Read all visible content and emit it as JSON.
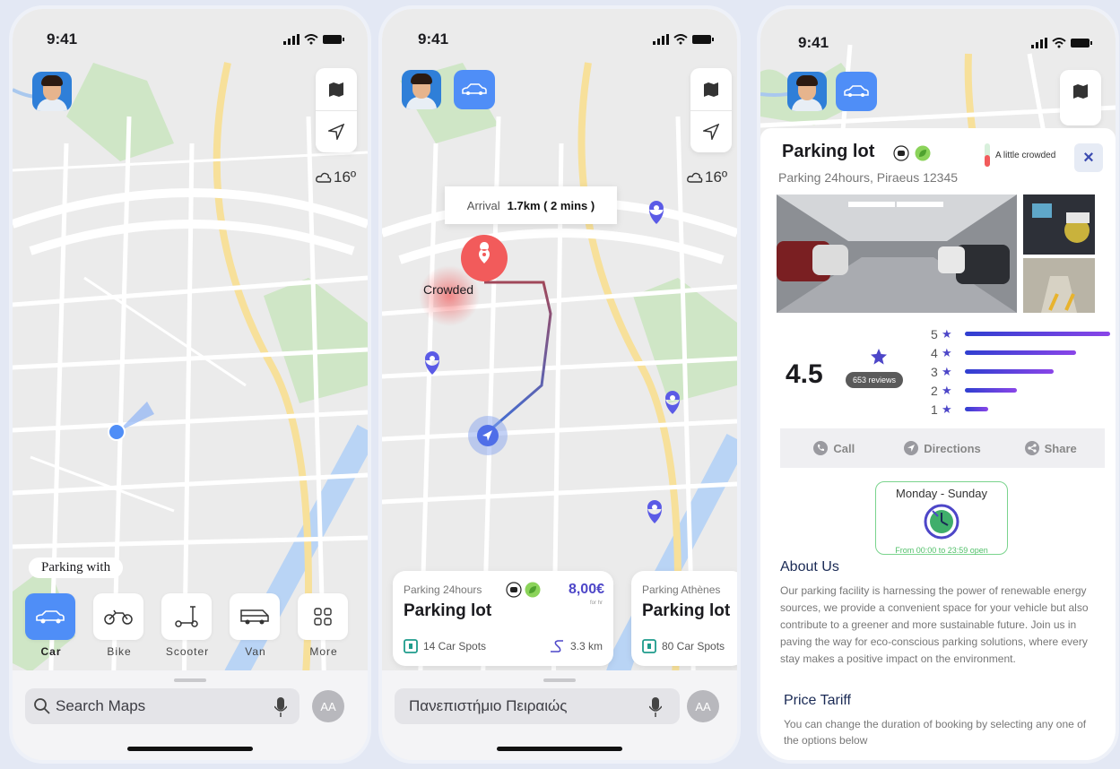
{
  "status": {
    "time": "9:41"
  },
  "phone1": {
    "weather": "16º",
    "parking_with": "Parking with",
    "vehicles": [
      {
        "label": "Car",
        "icon": "car-icon",
        "selected": true
      },
      {
        "label": "Bike",
        "icon": "motorbike-icon",
        "selected": false
      },
      {
        "label": "Scooter",
        "icon": "scooter-icon",
        "selected": false
      },
      {
        "label": "Van",
        "icon": "van-icon",
        "selected": false
      },
      {
        "label": "More",
        "icon": "grid-icon",
        "selected": false
      }
    ],
    "search_placeholder": "Search Maps",
    "profile_initials": "AA"
  },
  "phone2": {
    "weather": "16º",
    "arrival_label": "Arrival",
    "arrival_value": "1.7km ( 2 mins )",
    "crowded_label": "Crowded",
    "card1": {
      "subtitle": "Parking 24hours",
      "title": "Parking lot",
      "price": "8,00€",
      "price_unit": "for hr",
      "spots": "14 Car Spots",
      "distance": "3.3 km"
    },
    "card2": {
      "subtitle": "Parking Athènes",
      "title": "Parking lot",
      "spots": "80 Car Spots"
    },
    "search_value": "Πανεπιστήμιο Πειραιώς",
    "profile_initials": "AA"
  },
  "phone3": {
    "title": "Parking lot",
    "crowd_status": "A little crowded",
    "close_label": "×",
    "address": "Parking 24hours, Piraeus 12345",
    "rating": "4.5",
    "reviews": "653 reviews",
    "rating_bars": [
      {
        "stars": "5",
        "fraction": 0.95
      },
      {
        "stars": "4",
        "fraction": 0.73
      },
      {
        "stars": "3",
        "fraction": 0.58
      },
      {
        "stars": "2",
        "fraction": 0.34
      },
      {
        "stars": "1",
        "fraction": 0.15
      }
    ],
    "actions": {
      "call": "Call",
      "directions": "Directions",
      "share": "Share"
    },
    "hours_days": "Monday - Sunday",
    "hours_open": "From 00:00 to 23:59 open",
    "about_title": "About Us",
    "about_text": "Our parking facility is harnessing the power of renewable energy sources, we provide a convenient space for your vehicle but also contribute to a greener and more sustainable future. Join us in paving the way for eco-conscious parking solutions, where every stay makes a positive impact on the environment.",
    "tariff_title": "Price Tariff",
    "tariff_text": "You can change the duration of booking by selecting any one of the options below"
  },
  "colors": {
    "accent": "#4f8ef7",
    "purple": "#4d46c8",
    "pin": "#5b5be6",
    "crowd_red": "#f25b5b",
    "green": "#52c06a"
  }
}
